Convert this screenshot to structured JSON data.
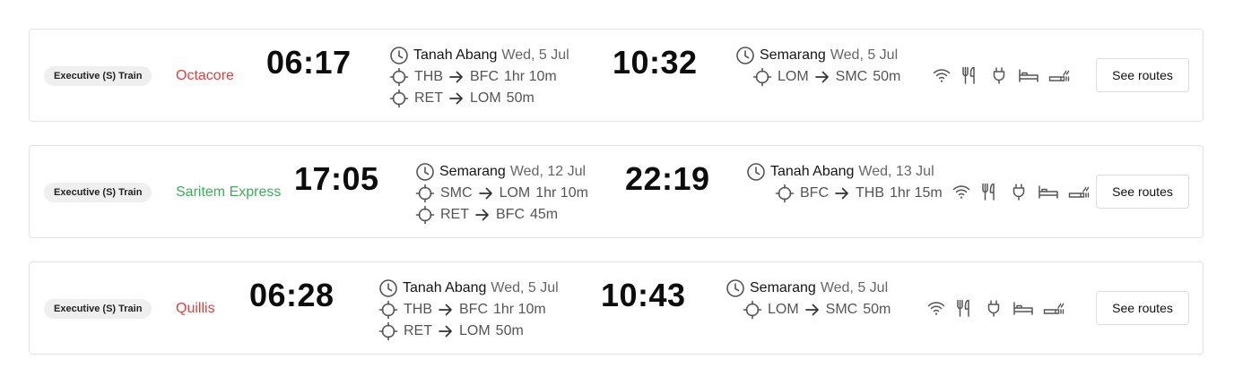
{
  "results": [
    {
      "class": "Executive (S) Train",
      "name": "Octacore",
      "name_color": "#d9433f",
      "departure_time": "06:17",
      "departure": {
        "station": "Tanah Abang",
        "date": "Wed, 5 Jul",
        "legs": [
          {
            "from": "THB",
            "to": "BFC",
            "duration": "1hr 10m"
          },
          {
            "from": "RET",
            "to": "LOM",
            "duration": "50m"
          }
        ]
      },
      "arrival_time": "10:32",
      "arrival": {
        "station": "Semarang",
        "date": "Wed, 5 Jul",
        "legs": [
          {
            "from": "LOM",
            "to": "SMC",
            "duration": "50m"
          }
        ]
      },
      "amenities": [
        "wifi-icon",
        "dining-icon",
        "power-plug-icon",
        "bed-icon",
        "smoking-icon"
      ],
      "button_label": "See routes"
    },
    {
      "class": "Executive (S) Train",
      "name": "Saritem Express",
      "name_color": "#3cae5a",
      "departure_time": "17:05",
      "departure": {
        "station": "Semarang",
        "date": "Wed, 12 Jul",
        "legs": [
          {
            "from": "SMC",
            "to": "LOM",
            "duration": "1hr 10m"
          },
          {
            "from": "RET",
            "to": "BFC",
            "duration": "45m"
          }
        ]
      },
      "arrival_time": "22:19",
      "arrival": {
        "station": "Tanah Abang",
        "date": "Wed, 13 Jul",
        "legs": [
          {
            "from": "BFC",
            "to": "THB",
            "duration": "1hr 15m"
          }
        ]
      },
      "amenities": [
        "wifi-icon",
        "dining-icon",
        "power-plug-icon",
        "bed-icon",
        "smoking-icon"
      ],
      "button_label": "See routes"
    },
    {
      "class": "Executive (S) Train",
      "name": "Quillis",
      "name_color": "#d9433f",
      "departure_time": "06:28",
      "departure": {
        "station": "Tanah Abang",
        "date": "Wed, 5 Jul",
        "legs": [
          {
            "from": "THB",
            "to": "BFC",
            "duration": "1hr 10m"
          },
          {
            "from": "RET",
            "to": "LOM",
            "duration": "50m"
          }
        ]
      },
      "arrival_time": "10:43",
      "arrival": {
        "station": "Semarang",
        "date": "Wed, 5 Jul",
        "legs": [
          {
            "from": "LOM",
            "to": "SMC",
            "duration": "50m"
          }
        ]
      },
      "amenities": [
        "wifi-icon",
        "dining-icon",
        "power-plug-icon",
        "bed-icon",
        "smoking-icon"
      ],
      "button_label": "See routes"
    }
  ]
}
